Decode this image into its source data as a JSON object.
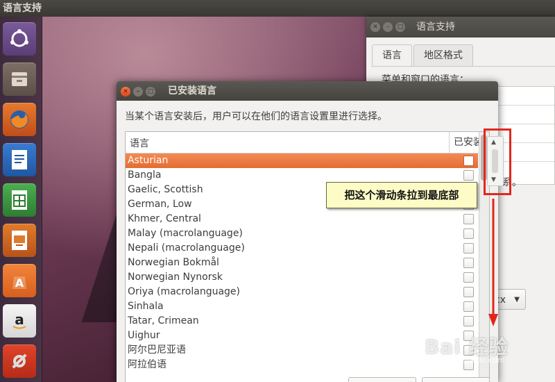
{
  "top_panel": {
    "app_title": "语言支持"
  },
  "back_window": {
    "title": "语言支持",
    "tabs": [
      {
        "label": "语言"
      },
      {
        "label": "地区格式"
      }
    ],
    "section_label": "菜单和窗口的语言：",
    "fragment_text": "系。",
    "select_value": "cx"
  },
  "dialog": {
    "title": "已安装语言",
    "description": "当某个语言安装后，用户可以在他们的语言设置里进行选择。",
    "columns": {
      "language": "语言",
      "installed": "已安装"
    },
    "rows": [
      {
        "name": "Asturian",
        "selected": true
      },
      {
        "name": "Bangla"
      },
      {
        "name": "Gaelic, Scottish"
      },
      {
        "name": "German, Low"
      },
      {
        "name": "Khmer, Central"
      },
      {
        "name": "Malay (macrolanguage)"
      },
      {
        "name": "Nepali (macrolanguage)"
      },
      {
        "name": "Norwegian Bokmål"
      },
      {
        "name": "Norwegian Nynorsk"
      },
      {
        "name": "Oriya (macrolanguage)"
      },
      {
        "name": "Sinhala"
      },
      {
        "name": "Tatar, Crimean"
      },
      {
        "name": "Uighur"
      },
      {
        "name": "阿尔巴尼亚语"
      },
      {
        "name": "阿拉伯语"
      }
    ]
  },
  "annotation": {
    "callout_text": "把这个滑动条拉到最底部"
  },
  "watermark": {
    "main": "Bai 经验",
    "sub": "jingyan.baidu.com"
  },
  "colors": {
    "selection": "#e8743b",
    "accent_red": "#e3261b",
    "callout_bg": "#fdfcc7"
  }
}
